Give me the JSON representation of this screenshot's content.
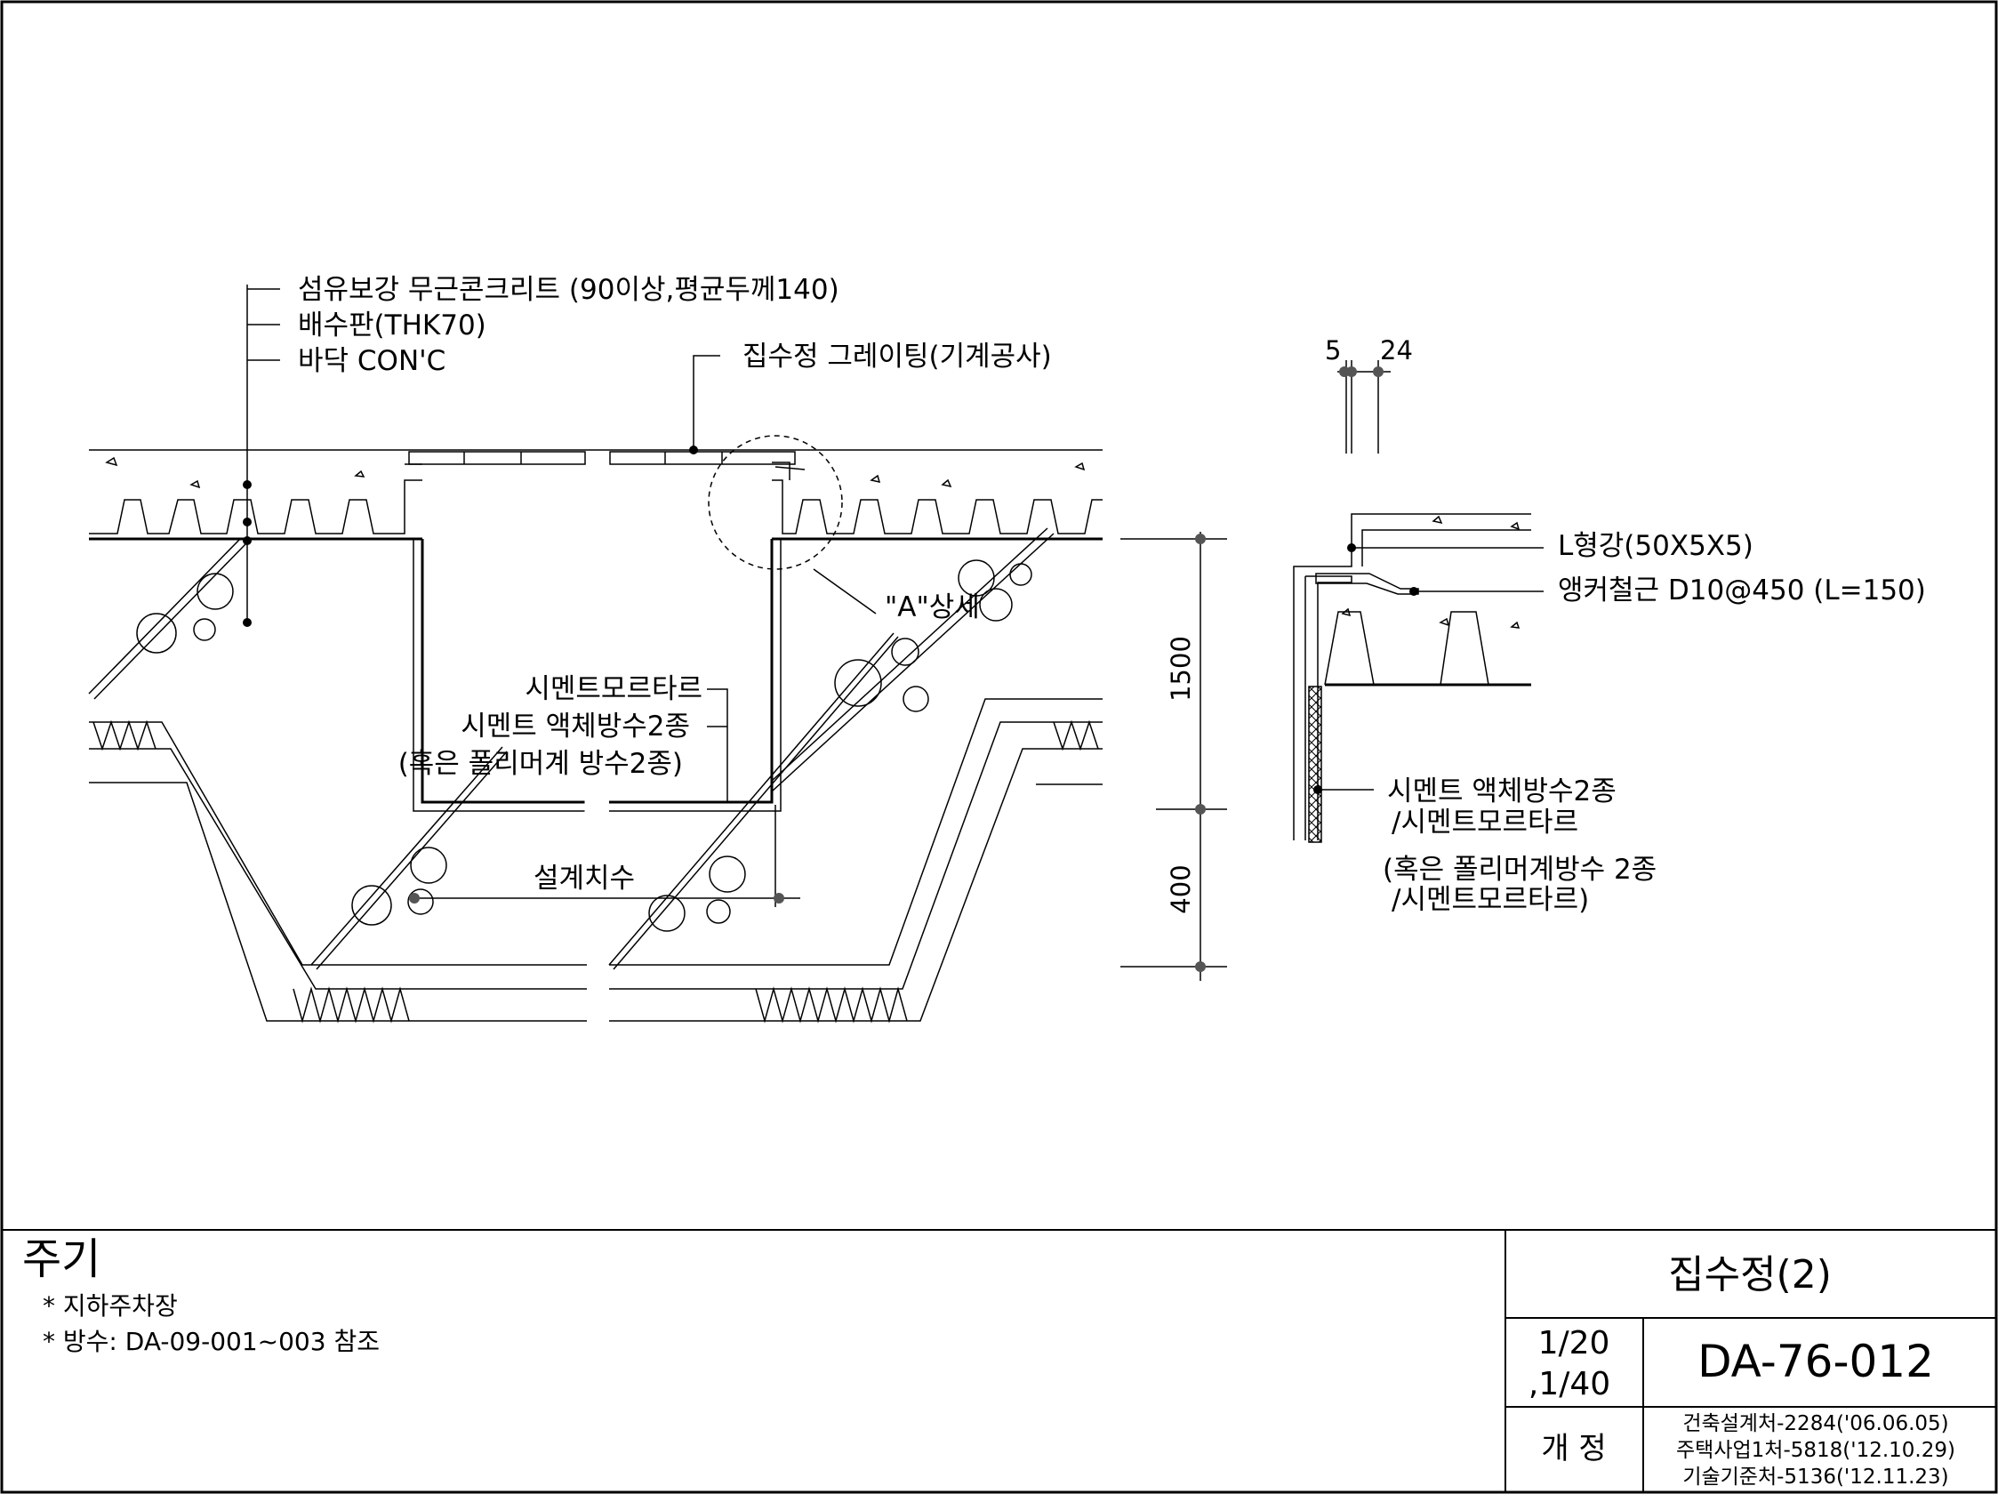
{
  "drawing": {
    "labels": {
      "layer_1": "섬유보강 무근콘크리트 (90이상,평균두께140)",
      "layer_2": "배수판(THK70)",
      "layer_3": "바닥 CON'C",
      "grating": "집수정 그레이팅(기계공사)",
      "detail_ref": "\"A\"상세",
      "mortar": "시멘트모르타르",
      "waterproof": "시멘트 액체방수2종",
      "waterproof_alt": "(혹은 폴리머계 방수2종)",
      "design_dim": "설계치수"
    },
    "dimensions": {
      "depth_upper": "1500",
      "depth_lower": "400",
      "detail_left": "5",
      "detail_right": "24"
    },
    "detail_a": {
      "angle": "L형강(50X5X5)",
      "anchor": "앵커철근 D10@450 (L=150)",
      "wp_line1": "시멘트 액체방수2종",
      "wp_line2": "/시멘트모르타르",
      "wp_line3": "(혹은 폴리머계방수 2종",
      "wp_line4": "/시멘트모르타르)"
    }
  },
  "notes": {
    "title": "주기",
    "items": [
      "* 지하주차장",
      "* 방수: DA-09-001~003 참조"
    ]
  },
  "title_block": {
    "title": "집수정(2)",
    "scale_line1": "1/20",
    "scale_line2": ",1/40",
    "drawing_no": "DA-76-012",
    "revision_label": "개  정",
    "revisions": [
      "건축설계처-2284('06.06.05)",
      "주택사업1처-5818('12.10.29)",
      "기술기준처-5136('12.11.23)"
    ]
  }
}
